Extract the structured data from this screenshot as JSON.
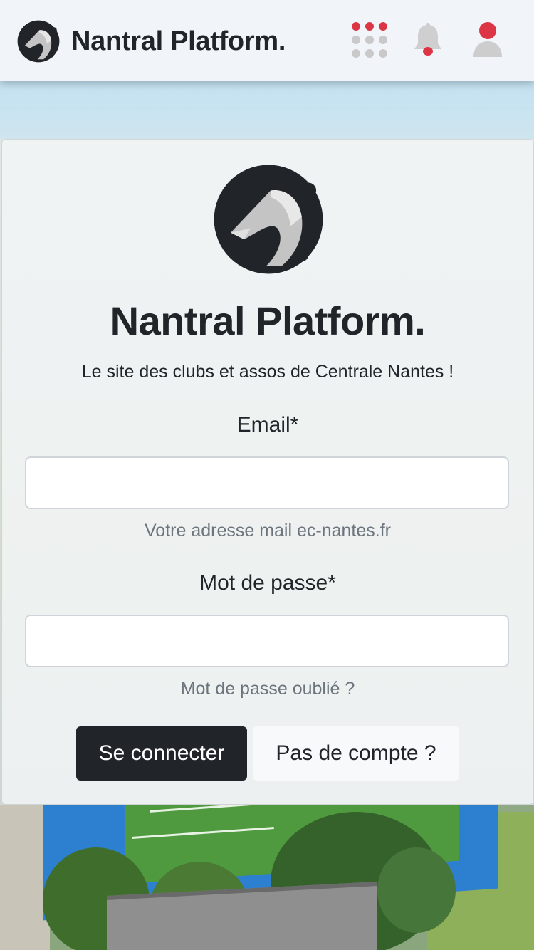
{
  "app": {
    "brand_name": "Nantral Platform.",
    "logo_icon": "horse-head-logo",
    "accent_color": "#dc3545",
    "dark_color": "#212529"
  },
  "header": {
    "apps_icon": "apps-grid-icon",
    "notifications_icon": "bell-icon",
    "profile_icon": "user-icon"
  },
  "login": {
    "title": "Nantral Platform.",
    "subtitle": "Le site des clubs et assos de Centrale Nantes !",
    "email": {
      "label": "Email*",
      "value": "",
      "help": "Votre adresse mail ec-nantes.fr"
    },
    "password": {
      "label": "Mot de passe*",
      "value": "",
      "help": "Mot de passe oublié ?"
    },
    "submit_label": "Se connecter",
    "signup_label": "Pas de compte ?"
  }
}
